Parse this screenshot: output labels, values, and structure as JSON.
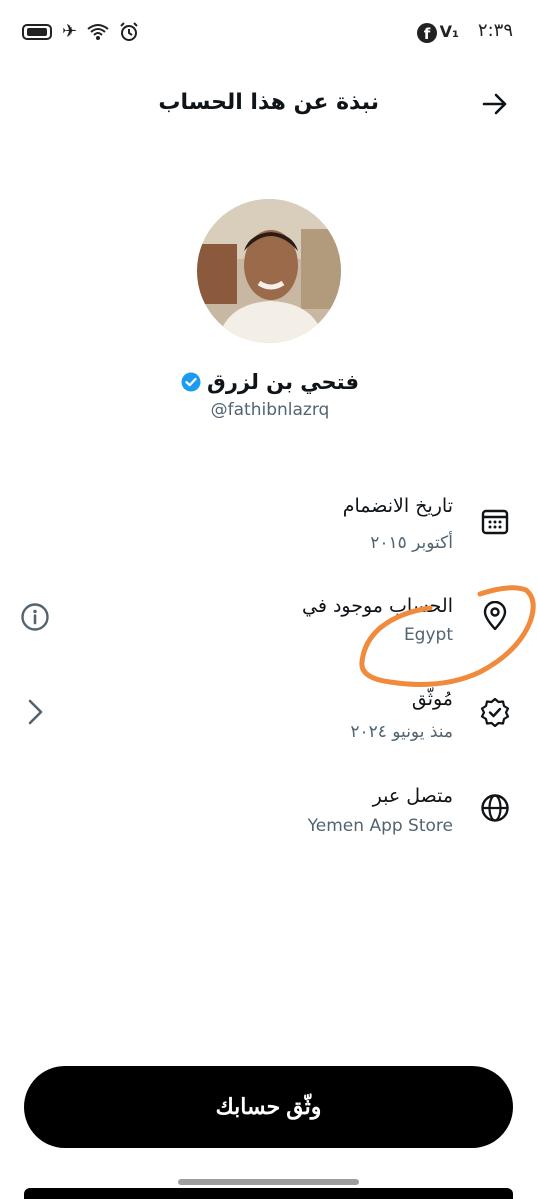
{
  "status_bar": {
    "time": "٢:٣٩",
    "network": "V₁",
    "facebook": "f",
    "icons": [
      "battery-icon",
      "airplane-icon",
      "wifi-icon",
      "alarm-icon"
    ]
  },
  "header": {
    "title": "نبذة عن هذا الحساب"
  },
  "profile": {
    "name": "فتحي بن لزرق",
    "handle": "@fathibnlazrq",
    "verified_color": "#1d9bf0"
  },
  "rows": [
    {
      "label": "تاريخ الانضمام",
      "value": "أكتوبر ٢٠١٥",
      "icon": "calendar-icon"
    },
    {
      "label": "الحساب موجود في",
      "value": "Egypt",
      "icon": "location-pin-icon"
    },
    {
      "label": "مُوثّق",
      "value": "منذ يونيو ٢٠٢٤",
      "icon": "verified-badge-icon"
    },
    {
      "label": "متصل عبر",
      "value": "Yemen App Store",
      "icon": "globe-icon"
    }
  ],
  "cta": {
    "label": "وثّق حسابك"
  },
  "colors": {
    "annotation": "#f08a3c",
    "secondary_text": "#536471"
  }
}
